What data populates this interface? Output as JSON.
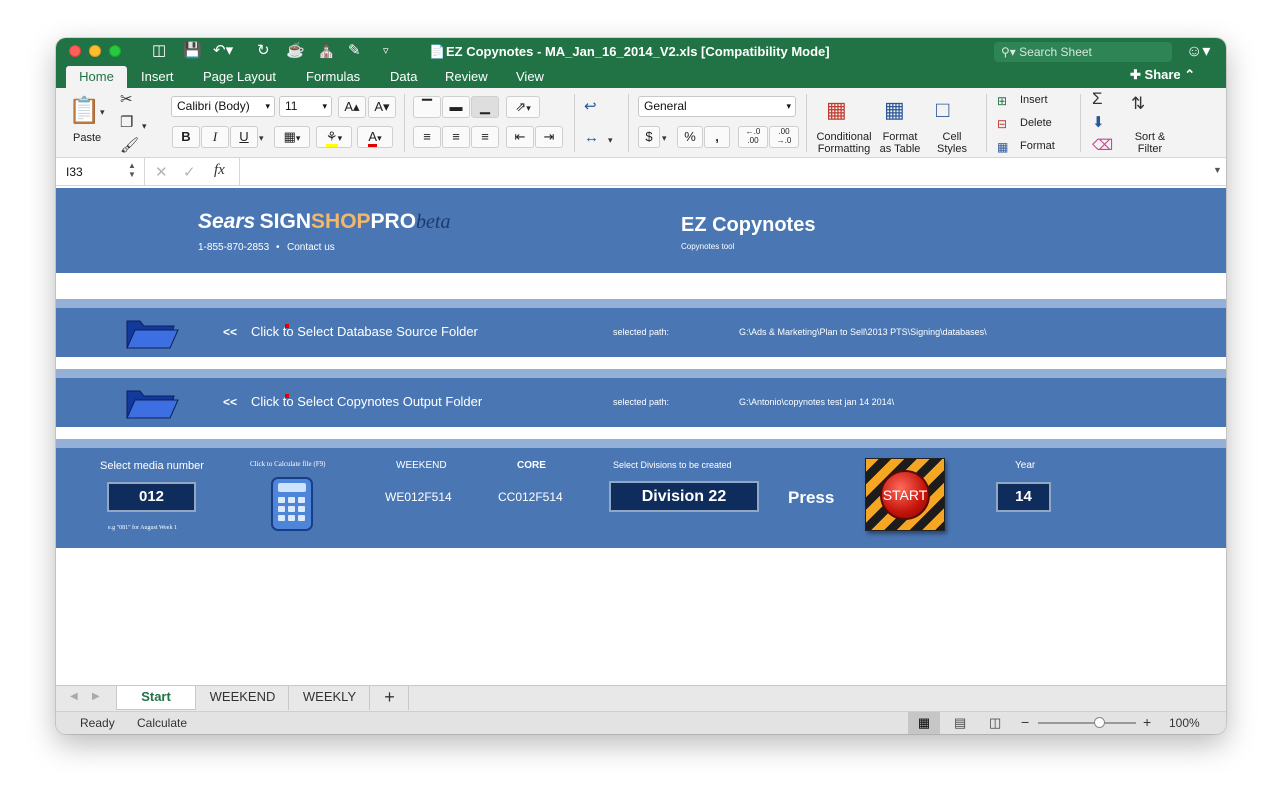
{
  "window": {
    "title": "EZ Copynotes - MA_Jan_16_2014_V2.xls  [Compatibility Mode]",
    "search_placeholder": "Search Sheet"
  },
  "ribbon_tabs": [
    "Home",
    "Insert",
    "Page Layout",
    "Formulas",
    "Data",
    "Review",
    "View"
  ],
  "share_label": "Share",
  "ribbon": {
    "paste": "Paste",
    "font_name": "Calibri (Body)",
    "font_size": "11",
    "bold": "B",
    "italic": "I",
    "underline": "U",
    "number_format": "General",
    "currency": "$",
    "percent": "%",
    "comma": ",",
    "conditional_formatting": [
      "Conditional",
      "Formatting"
    ],
    "format_as_table": [
      "Format",
      "as Table"
    ],
    "cell_styles": [
      "Cell",
      "Styles"
    ],
    "insert": "Insert",
    "delete": "Delete",
    "format": "Format",
    "sort_filter": [
      "Sort &",
      "Filter"
    ]
  },
  "formula_bar": {
    "cell_ref": "I33",
    "fx": "fx",
    "formula": ""
  },
  "sheet": {
    "header": {
      "brand_sears": "Sears",
      "brand_sign": "SIGN",
      "brand_shop": "SHOP",
      "brand_pro": "PRO",
      "brand_beta": "beta",
      "phone": "1-855-870-2853",
      "bullet": "•",
      "contact": "Contact us",
      "app_title": "EZ Copynotes",
      "app_subtitle": "Copynotes tool"
    },
    "database_row": {
      "arrow": "<<",
      "label": "Click to Select Database Source Folder",
      "path_label": "selected path:",
      "path": "G:\\Ads & Marketing\\Plan to Sell\\2013 PTS\\Signing\\databases\\"
    },
    "output_row": {
      "arrow": "<<",
      "label": "Click to Select Copynotes Output Folder",
      "path_label": "selected path:",
      "path": "G:\\Antonio\\copynotes test jan 14 2014\\"
    },
    "controls": {
      "media_label": "Select media number",
      "media_value": "012",
      "media_hint": "e.g \"081\" for August Week 1",
      "calc_label": "Click to Calculate file (F9)",
      "weekend_label": "WEEKEND",
      "weekend_value": "WE012F514",
      "core_label": "CORE",
      "core_value": "CC012F514",
      "divisions_label": "Select Divisions to be created",
      "division_value": "Division 22",
      "press_label": "Press",
      "start_label": "START",
      "year_label": "Year",
      "year_value": "14"
    }
  },
  "sheet_tabs": [
    "Start",
    "WEEKEND",
    "WEEKLY"
  ],
  "add_sheet": "+",
  "status_bar": {
    "ready": "Ready",
    "calculate": "Calculate",
    "zoom_minus": "−",
    "zoom_plus": "+",
    "zoom": "100%",
    "zoom_level_percent": 100
  },
  "colors": {
    "excel_green": "#217346",
    "band_blue": "#4a77b4",
    "light_band": "#94b0d6",
    "navy_box": "#0f2d5c"
  }
}
